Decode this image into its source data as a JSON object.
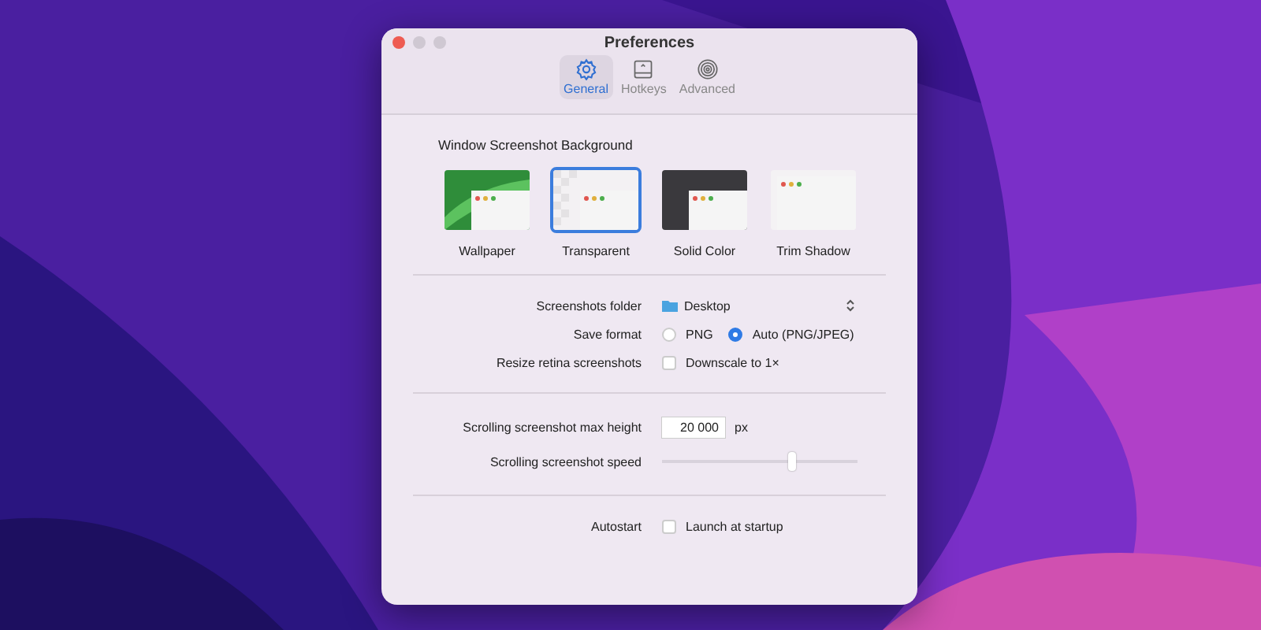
{
  "window": {
    "title": "Preferences"
  },
  "tabs": [
    {
      "label": "General",
      "selected": true
    },
    {
      "label": "Hotkeys",
      "selected": false
    },
    {
      "label": "Advanced",
      "selected": false
    }
  ],
  "background_section": {
    "title": "Window Screenshot Background",
    "options": [
      {
        "label": "Wallpaper",
        "kind": "wallpaper",
        "selected": false
      },
      {
        "label": "Transparent",
        "kind": "transparent",
        "selected": true
      },
      {
        "label": "Solid Color",
        "kind": "solid",
        "selected": false
      },
      {
        "label": "Trim Shadow",
        "kind": "trim",
        "selected": false
      }
    ]
  },
  "settings": [
    {
      "kind": "folder",
      "label": "Screenshots folder",
      "value": "Desktop"
    },
    {
      "kind": "radio",
      "label": "Save format",
      "options": [
        {
          "label": "PNG",
          "selected": false
        },
        {
          "label": "Auto (PNG/JPEG)",
          "selected": true
        }
      ]
    },
    {
      "kind": "checkbox",
      "label": "Resize retina screenshots",
      "text": "Downscale to 1×",
      "checked": false
    },
    {
      "kind": "divider"
    },
    {
      "kind": "number",
      "label": "Scrolling screenshot max height",
      "value": "20 000",
      "unit": "px"
    },
    {
      "kind": "slider",
      "label": "Scrolling screenshot speed",
      "level": 0.66
    },
    {
      "kind": "divider"
    },
    {
      "kind": "checkbox",
      "label": "Autostart",
      "text": "Launch at startup",
      "checked": false
    }
  ]
}
